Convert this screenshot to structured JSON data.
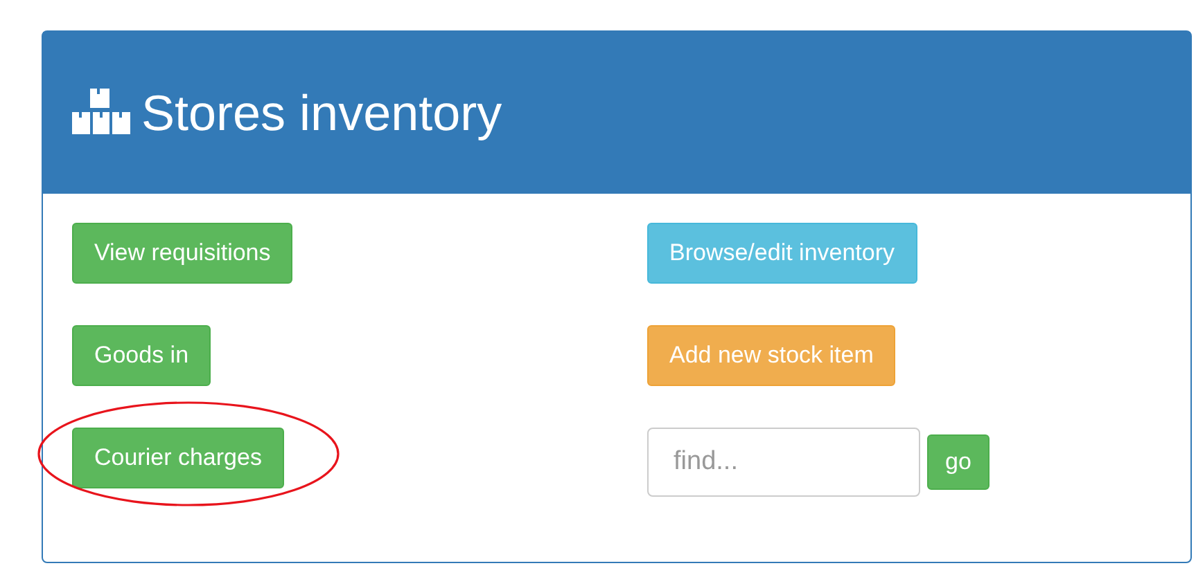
{
  "panel": {
    "title": "Stores inventory"
  },
  "actions": [
    {
      "label": "View requisitions",
      "kind": "success",
      "circled": false
    },
    {
      "label": "Browse/edit inventory",
      "kind": "info",
      "circled": false
    },
    {
      "label": "Goods in",
      "kind": "success",
      "circled": false
    },
    {
      "label": "Add new stock item",
      "kind": "warning",
      "circled": false
    },
    {
      "label": "Courier charges",
      "kind": "success",
      "circled": true
    }
  ],
  "search": {
    "placeholder": "find...",
    "button": "go"
  }
}
